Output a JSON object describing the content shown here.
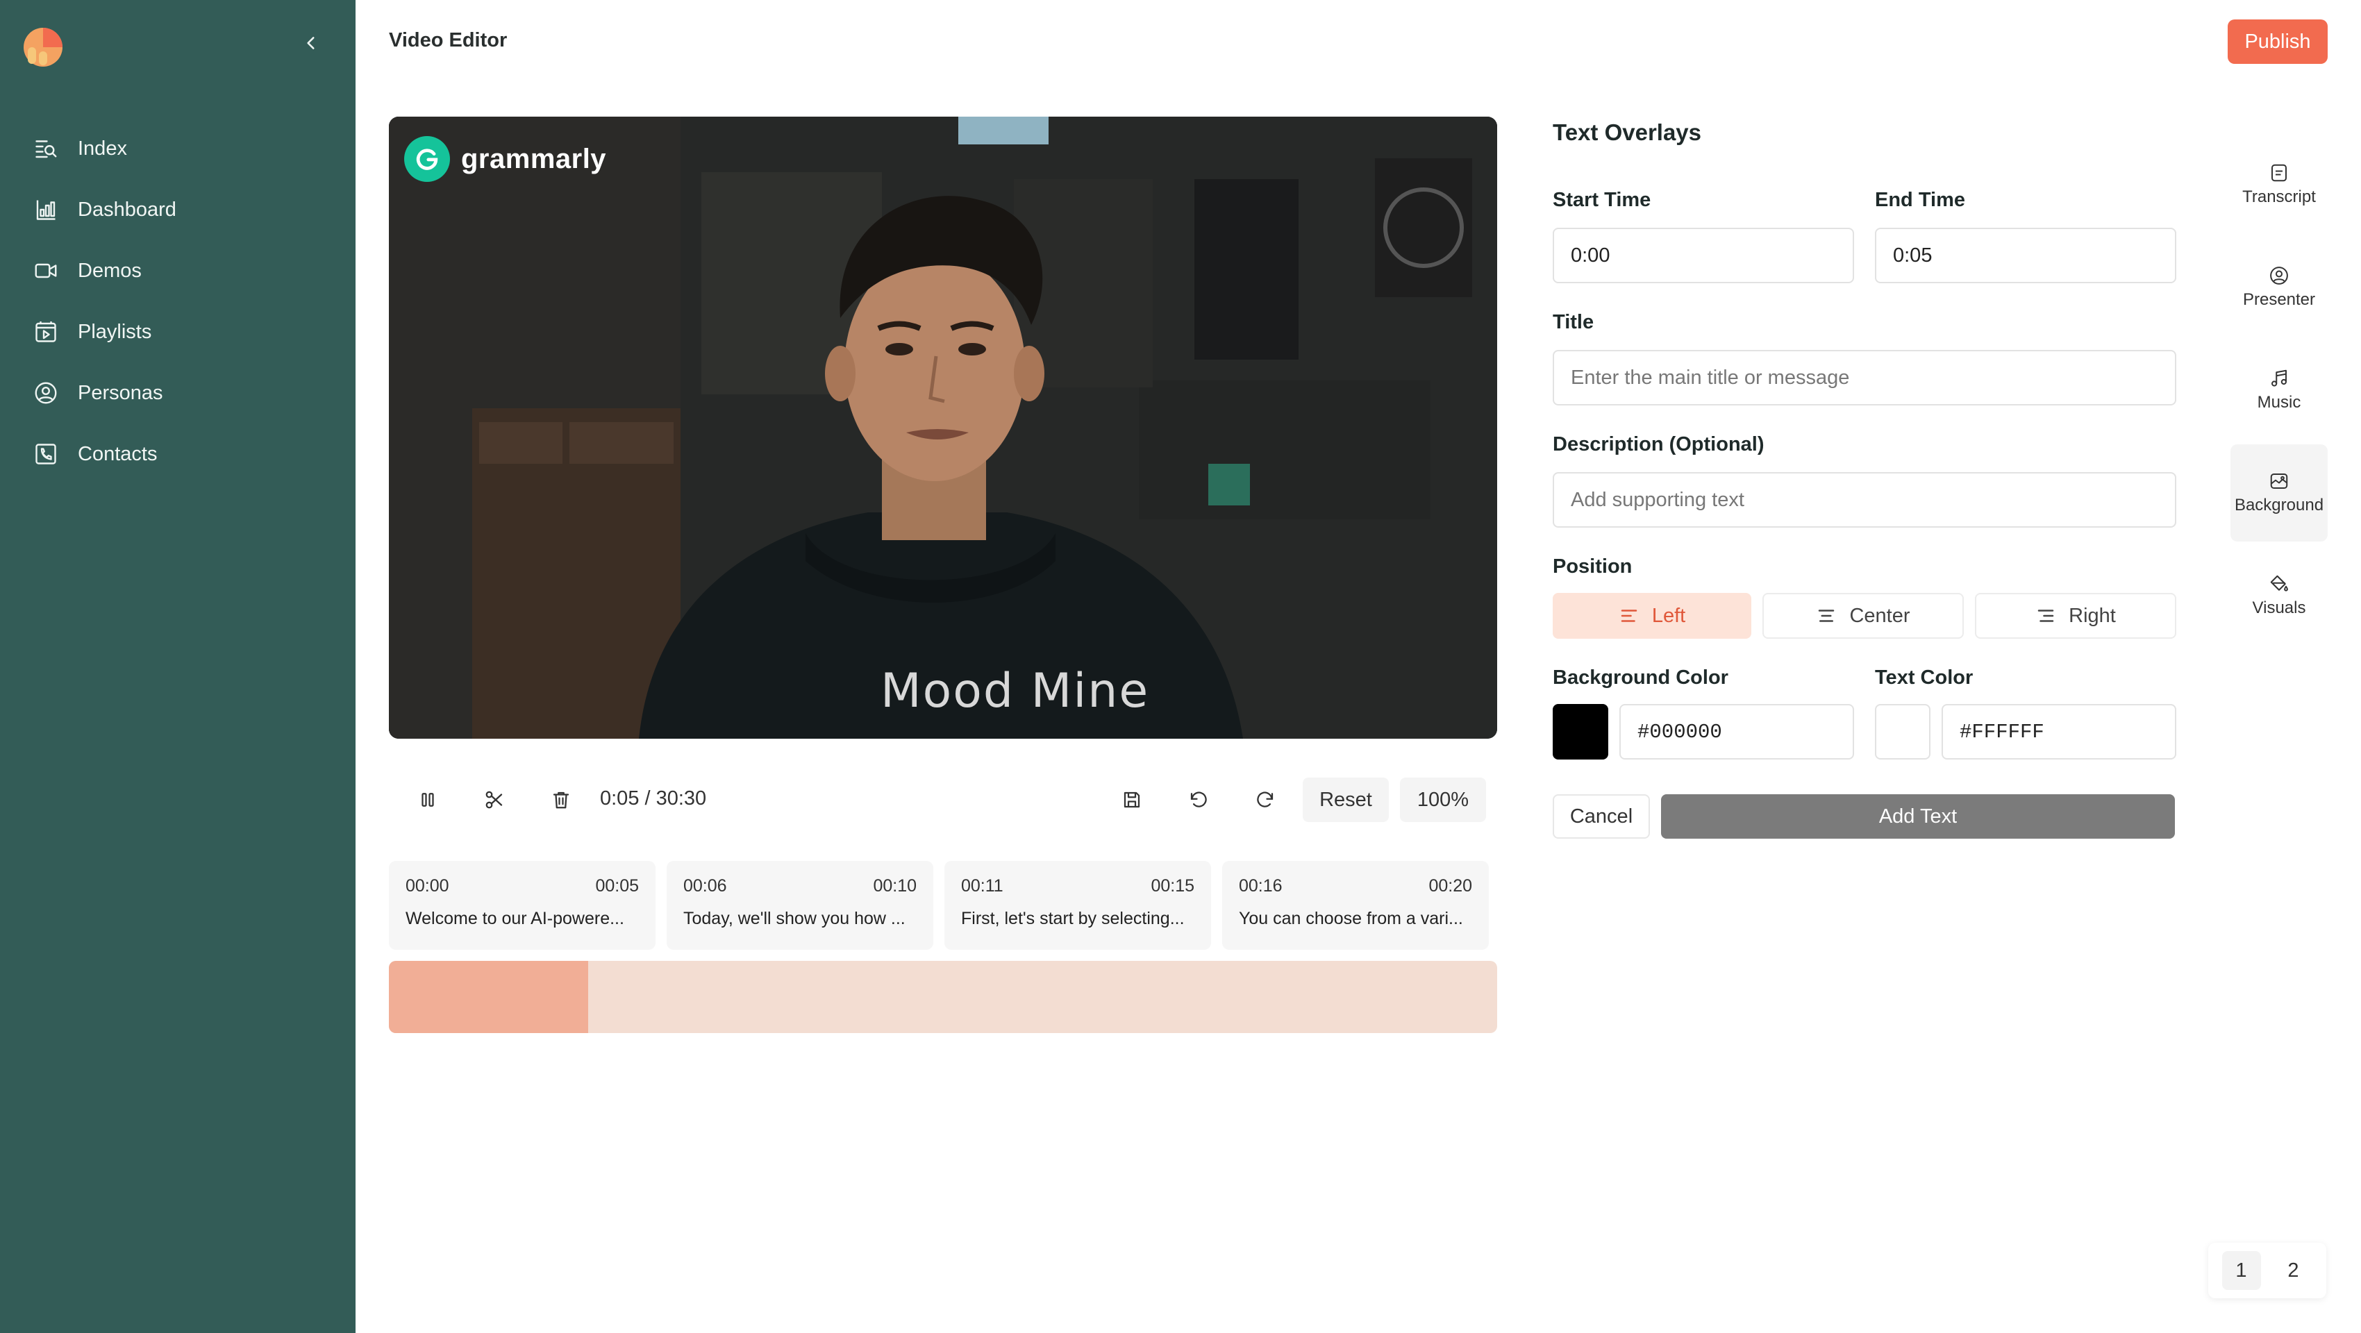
{
  "sidebar": {
    "items": [
      {
        "label": "Index",
        "icon": "index-icon"
      },
      {
        "label": "Dashboard",
        "icon": "dashboard-icon"
      },
      {
        "label": "Demos",
        "icon": "video-icon"
      },
      {
        "label": "Playlists",
        "icon": "playlist-icon"
      },
      {
        "label": "Personas",
        "icon": "persona-icon"
      },
      {
        "label": "Contacts",
        "icon": "contacts-icon"
      }
    ]
  },
  "header": {
    "title": "Video Editor",
    "publish_label": "Publish"
  },
  "video": {
    "brand_name": "grammarly",
    "shirt_text": "Mood Mine"
  },
  "controls": {
    "time": "0:05 / 30:30",
    "reset_label": "Reset",
    "zoom": "100%"
  },
  "segments": [
    {
      "start": "00:00",
      "end": "00:05",
      "text": "Welcome to our AI-powere..."
    },
    {
      "start": "00:06",
      "end": "00:10",
      "text": "Today, we'll show you how ..."
    },
    {
      "start": "00:11",
      "end": "00:15",
      "text": "First, let's start by selecting..."
    },
    {
      "start": "00:16",
      "end": "00:20",
      "text": "You can choose from a vari..."
    }
  ],
  "timeline": {
    "progress": 0.18
  },
  "overlay_panel": {
    "title": "Text Overlays",
    "start_time_label": "Start Time",
    "start_time_value": "0:00",
    "end_time_label": "End Time",
    "end_time_value": "0:05",
    "title_label": "Title",
    "title_placeholder": "Enter the main title or message",
    "description_label": "Description (Optional)",
    "description_placeholder": "Add supporting text",
    "position_label": "Position",
    "positions": [
      "Left",
      "Center",
      "Right"
    ],
    "active_position": "Left",
    "bg_color_label": "Background Color",
    "bg_color_value": "#000000",
    "text_color_label": "Text Color",
    "text_color_value": "#FFFFFF",
    "cancel_label": "Cancel",
    "add_label": "Add Text"
  },
  "rail": [
    {
      "label": "Transcript",
      "icon": "transcript-icon"
    },
    {
      "label": "Presenter",
      "icon": "presenter-icon"
    },
    {
      "label": "Music",
      "icon": "music-icon"
    },
    {
      "label": "Background",
      "icon": "background-icon",
      "active": true
    },
    {
      "label": "Visuals",
      "icon": "paint-bucket-icon"
    }
  ],
  "pagination": {
    "pages": [
      "1",
      "2"
    ],
    "current": "1"
  },
  "colors": {
    "sidebar": "#335c57",
    "accent": "#f26b4f",
    "timeline_fill": "#f1ae96",
    "timeline_track": "#f3ddd2"
  }
}
